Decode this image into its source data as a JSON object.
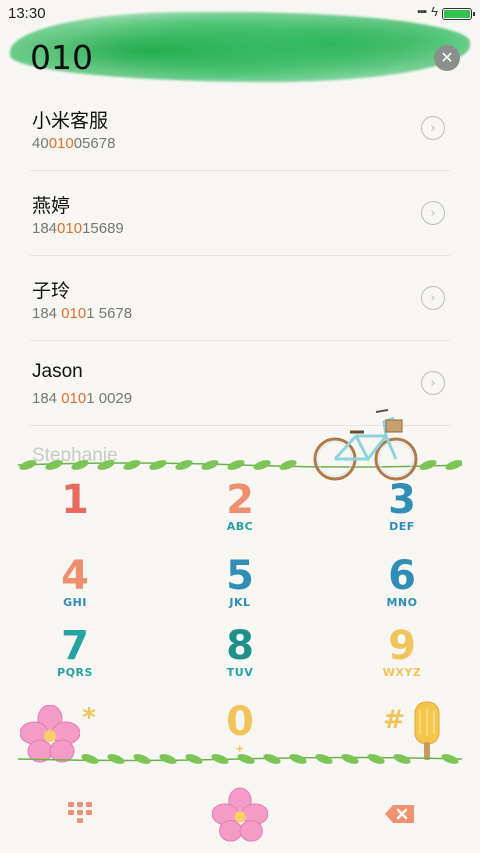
{
  "status_bar": {
    "time": "13:30",
    "battery_level": 1.0,
    "battery_color": "#32c24d"
  },
  "dialer": {
    "input_value": "010"
  },
  "results": [
    {
      "name": "小米客服",
      "number_pre": "40",
      "number_match": "010",
      "number_post": "05678"
    },
    {
      "name": "燕婷",
      "number_pre": "184",
      "number_match": "010",
      "number_post": "15689"
    },
    {
      "name": "子玲",
      "number_pre": "184 ",
      "number_match": "010",
      "number_post": "1 5678"
    },
    {
      "name": "Jason",
      "number_pre": "184 ",
      "number_match": "010",
      "number_post": "1 0029"
    }
  ],
  "partial_result": {
    "name": "Stephanie"
  },
  "keypad": {
    "keys": [
      {
        "digit": "1",
        "letters": ""
      },
      {
        "digit": "2",
        "letters": "ABC"
      },
      {
        "digit": "3",
        "letters": "DEF"
      },
      {
        "digit": "4",
        "letters": "GHI"
      },
      {
        "digit": "5",
        "letters": "JKL"
      },
      {
        "digit": "6",
        "letters": "MNO"
      },
      {
        "digit": "7",
        "letters": "PQRS"
      },
      {
        "digit": "8",
        "letters": "TUV"
      },
      {
        "digit": "9",
        "letters": "WXYZ"
      },
      {
        "digit": "*",
        "letters": ""
      },
      {
        "digit": "0",
        "letters": "+"
      },
      {
        "digit": "#",
        "letters": ""
      }
    ]
  },
  "colors": {
    "highlight": "#e0702e",
    "header_wash": "#2bb55a"
  },
  "icons": {
    "clear": "close-icon",
    "detail": "chevron-right-icon",
    "keypad_toggle": "dialpad-icon",
    "backspace": "backspace-icon",
    "decor": [
      "bicycle-icon",
      "flower-icon",
      "popsicle-icon",
      "leaf-vine-icon"
    ]
  }
}
